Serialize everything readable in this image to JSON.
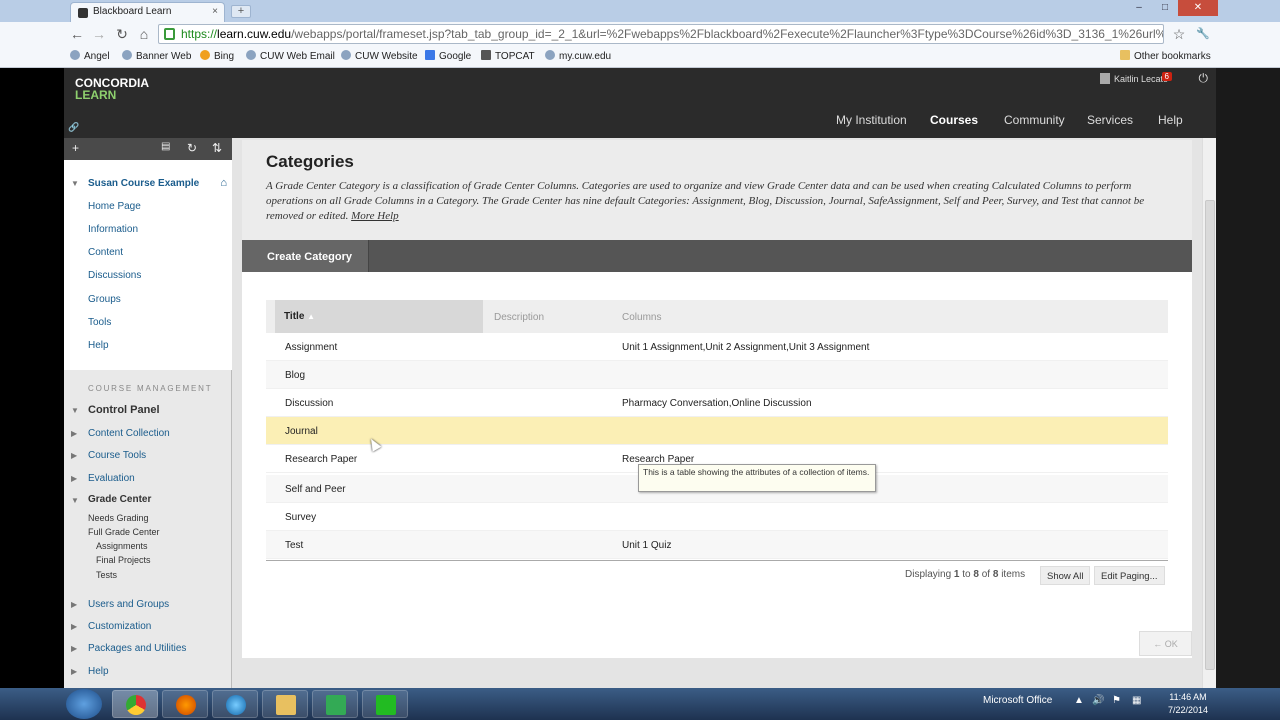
{
  "browser": {
    "tab_title": "Blackboard Learn",
    "tab_close": "×",
    "new_tab": "+",
    "url_https": "https://",
    "url_host": "learn.cuw.edu",
    "url_rest": "/webapps/portal/frameset.jsp?tab_tab_group_id=_2_1&url=%2Fwebapps%2Fblackboard%2Fexecute%2Flauncher%3Ftype%3DCourse%26id%3D_3136_1%26url%3D",
    "back": "←",
    "forward": "→",
    "reload": "↻",
    "home": "⌂",
    "star": "☆",
    "wrench": "🔧",
    "win_min": "–",
    "win_max": "□",
    "win_close": "✕",
    "bookmarks": [
      "Angel",
      "Banner Web",
      "Bing",
      "CUW Web Email",
      "CUW Website",
      "Google",
      "TOPCAT",
      "my.cuw.edu"
    ],
    "other_bookmarks": "Other bookmarks"
  },
  "header": {
    "logo_line1": "CONCORDIA",
    "logo_line2": "LEARN",
    "user_name": "Kaitlin Lecato",
    "notifications": "6",
    "power_icon": "⏻",
    "tabs": [
      "My Institution",
      "Courses",
      "Community",
      "Services",
      "Help"
    ],
    "active_tab": "Courses"
  },
  "sidebar": {
    "toolbar_icons": [
      "+",
      "▤",
      "↻",
      "⇅"
    ],
    "course_title": "Susan Course Example",
    "course_links": [
      "Home Page",
      "Information",
      "Content",
      "Discussions",
      "Groups",
      "Tools",
      "Help"
    ],
    "management_heading": "COURSE MANAGEMENT",
    "control_panel": "Control Panel",
    "cp_items": [
      "Content Collection",
      "Course Tools",
      "Evaluation"
    ],
    "grade_center": "Grade Center",
    "gc_items": [
      "Needs Grading",
      "Full Grade Center"
    ],
    "gc_sub_items": [
      "Assignments",
      "Final Projects",
      "Tests"
    ],
    "bottom_items": [
      "Users and Groups",
      "Customization",
      "Packages and Utilities",
      "Help"
    ]
  },
  "main": {
    "title": "Categories",
    "description": "A Grade Center Category is a classification of Grade Center Columns. Categories are used to organize and view Grade Center data and can be used when creating Calculated Columns to perform operations on all Grade Columns in a Category. The Grade Center has nine default Categories: Assignment, Blog, Discussion, Journal, SafeAssignment, Self and Peer, Survey, and Test that cannot be removed or edited.",
    "more_help": "More Help",
    "create_button": "Create Category",
    "columns": {
      "title": "Title",
      "description": "Description",
      "columns": "Columns"
    },
    "rows": [
      {
        "title": "Assignment",
        "columns": "Unit 1 Assignment,Unit 2 Assignment,Unit 3 Assignment"
      },
      {
        "title": "Blog",
        "columns": ""
      },
      {
        "title": "Discussion",
        "columns": "Pharmacy Conversation,Online Discussion"
      },
      {
        "title": "Journal",
        "columns": ""
      },
      {
        "title": "Research Paper",
        "columns": "Research Paper"
      },
      {
        "title": "Self and Peer",
        "columns": ""
      },
      {
        "title": "Survey",
        "columns": ""
      },
      {
        "title": "Test",
        "columns": "Unit 1 Quiz"
      }
    ],
    "tooltip": "This is a table showing the attributes of a collection of items.",
    "paging_prefix": "Displaying ",
    "paging_from": "1",
    "paging_mid": " to ",
    "paging_to": "8",
    "paging_of": " of ",
    "paging_total": "8",
    "paging_suffix": " items",
    "show_all": "Show All",
    "edit_paging": "Edit Paging...",
    "ok": "← OK"
  },
  "taskbar": {
    "tray_label": "Microsoft Office",
    "time": "11:46 AM",
    "date": "7/22/2014"
  }
}
